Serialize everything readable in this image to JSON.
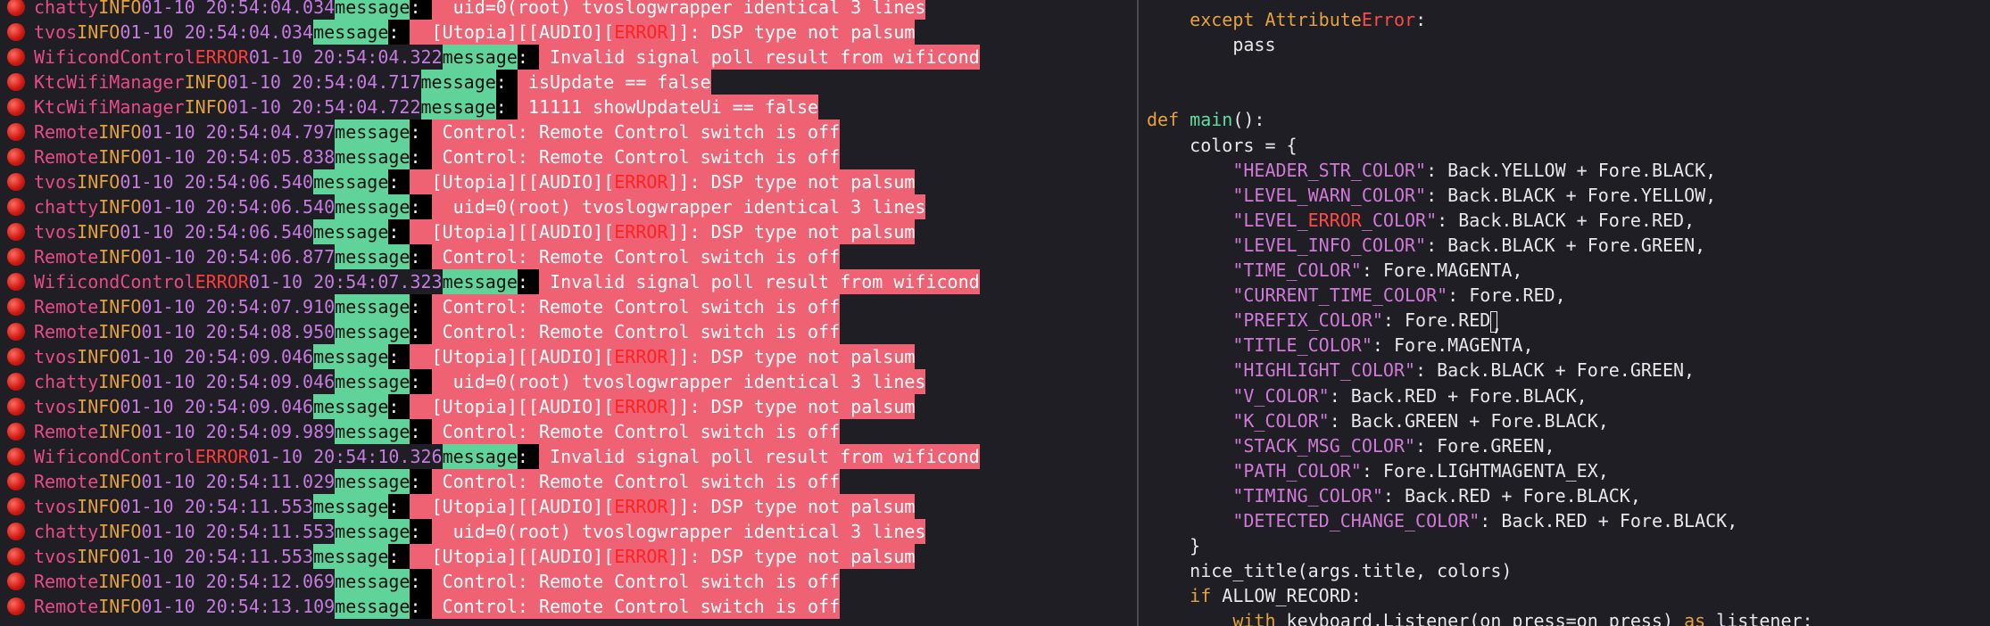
{
  "log": {
    "lines": [
      {
        "tag": "chatty",
        "level": "INFO",
        "time": "01-10 20:54:04.034",
        "key": "message",
        "pre": "  uid=0(root) tvoslogwrapper identical 3 lines",
        "err": "",
        "post": ""
      },
      {
        "tag": "tvos",
        "level": "INFO",
        "time": "01-10 20:54:04.034",
        "key": "message",
        "pre": "  [Utopia][[AUDIO][",
        "err": "ERROR",
        "post": "]]: DSP type not palsum"
      },
      {
        "tag": "WificondControl",
        "level": "ERROR",
        "time": "01-10 20:54:04.322",
        "key": "message",
        "pre": " Invalid signal poll result from wificond",
        "err": "",
        "post": ""
      },
      {
        "tag": "KtcWifiManager",
        "level": "INFO",
        "time": "01-10 20:54:04.717",
        "key": "message",
        "pre": " isUpdate == false",
        "err": "",
        "post": ""
      },
      {
        "tag": "KtcWifiManager",
        "level": "INFO",
        "time": "01-10 20:54:04.722",
        "key": "message",
        "pre": " 11111 showUpdateUi == false",
        "err": "",
        "post": ""
      },
      {
        "tag": "Remote",
        "level": "INFO",
        "time": "01-10 20:54:04.797",
        "key": "message",
        "pre": " Control: Remote Control switch is off",
        "err": "",
        "post": ""
      },
      {
        "tag": "Remote",
        "level": "INFO",
        "time": "01-10 20:54:05.838",
        "key": "message",
        "pre": " Control: Remote Control switch is off",
        "err": "",
        "post": ""
      },
      {
        "tag": "tvos",
        "level": "INFO",
        "time": "01-10 20:54:06.540",
        "key": "message",
        "pre": "  [Utopia][[AUDIO][",
        "err": "ERROR",
        "post": "]]: DSP type not palsum"
      },
      {
        "tag": "chatty",
        "level": "INFO",
        "time": "01-10 20:54:06.540",
        "key": "message",
        "pre": "  uid=0(root) tvoslogwrapper identical 3 lines",
        "err": "",
        "post": ""
      },
      {
        "tag": "tvos",
        "level": "INFO",
        "time": "01-10 20:54:06.540",
        "key": "message",
        "pre": "  [Utopia][[AUDIO][",
        "err": "ERROR",
        "post": "]]: DSP type not palsum"
      },
      {
        "tag": "Remote",
        "level": "INFO",
        "time": "01-10 20:54:06.877",
        "key": "message",
        "pre": " Control: Remote Control switch is off",
        "err": "",
        "post": ""
      },
      {
        "tag": "WificondControl",
        "level": "ERROR",
        "time": "01-10 20:54:07.323",
        "key": "message",
        "pre": " Invalid signal poll result from wificond",
        "err": "",
        "post": ""
      },
      {
        "tag": "Remote",
        "level": "INFO",
        "time": "01-10 20:54:07.910",
        "key": "message",
        "pre": " Control: Remote Control switch is off",
        "err": "",
        "post": ""
      },
      {
        "tag": "Remote",
        "level": "INFO",
        "time": "01-10 20:54:08.950",
        "key": "message",
        "pre": " Control: Remote Control switch is off",
        "err": "",
        "post": ""
      },
      {
        "tag": "tvos",
        "level": "INFO",
        "time": "01-10 20:54:09.046",
        "key": "message",
        "pre": "  [Utopia][[AUDIO][",
        "err": "ERROR",
        "post": "]]: DSP type not palsum"
      },
      {
        "tag": "chatty",
        "level": "INFO",
        "time": "01-10 20:54:09.046",
        "key": "message",
        "pre": "  uid=0(root) tvoslogwrapper identical 3 lines",
        "err": "",
        "post": ""
      },
      {
        "tag": "tvos",
        "level": "INFO",
        "time": "01-10 20:54:09.046",
        "key": "message",
        "pre": "  [Utopia][[AUDIO][",
        "err": "ERROR",
        "post": "]]: DSP type not palsum"
      },
      {
        "tag": "Remote",
        "level": "INFO",
        "time": "01-10 20:54:09.989",
        "key": "message",
        "pre": " Control: Remote Control switch is off",
        "err": "",
        "post": ""
      },
      {
        "tag": "WificondControl",
        "level": "ERROR",
        "time": "01-10 20:54:10.326",
        "key": "message",
        "pre": " Invalid signal poll result from wificond",
        "err": "",
        "post": ""
      },
      {
        "tag": "Remote",
        "level": "INFO",
        "time": "01-10 20:54:11.029",
        "key": "message",
        "pre": " Control: Remote Control switch is off",
        "err": "",
        "post": ""
      },
      {
        "tag": "tvos",
        "level": "INFO",
        "time": "01-10 20:54:11.553",
        "key": "message",
        "pre": "  [Utopia][[AUDIO][",
        "err": "ERROR",
        "post": "]]: DSP type not palsum"
      },
      {
        "tag": "chatty",
        "level": "INFO",
        "time": "01-10 20:54:11.553",
        "key": "message",
        "pre": "  uid=0(root) tvoslogwrapper identical 3 lines",
        "err": "",
        "post": ""
      },
      {
        "tag": "tvos",
        "level": "INFO",
        "time": "01-10 20:54:11.553",
        "key": "message",
        "pre": "  [Utopia][[AUDIO][",
        "err": "ERROR",
        "post": "]]: DSP type not palsum"
      },
      {
        "tag": "Remote",
        "level": "INFO",
        "time": "01-10 20:54:12.069",
        "key": "message",
        "pre": " Control: Remote Control switch is off",
        "err": "",
        "post": ""
      },
      {
        "tag": "Remote",
        "level": "INFO",
        "time": "01-10 20:54:13.109",
        "key": "message",
        "pre": " Control: Remote Control switch is off",
        "err": "",
        "post": ""
      }
    ]
  },
  "editor": {
    "lines": [
      [
        {
          "t": "    "
        },
        {
          "t": "except",
          "c": "kw"
        },
        {
          "t": " "
        },
        {
          "t": "Attribute",
          "c": "cls"
        },
        {
          "t": "Error",
          "c": "err"
        },
        {
          "t": ":"
        }
      ],
      [
        {
          "t": "        pass"
        }
      ],
      [
        {
          "t": ""
        }
      ],
      [
        {
          "t": ""
        }
      ],
      [
        {
          "t": "def",
          "c": "kw"
        },
        {
          "t": " "
        },
        {
          "t": "main",
          "c": "fn"
        },
        {
          "t": "():"
        }
      ],
      [
        {
          "t": "    colors = {"
        }
      ],
      [
        {
          "t": "        "
        },
        {
          "t": "\"HEADER_STR_COLOR\"",
          "c": "str"
        },
        {
          "t": ": Back.YELLOW + Fore.BLACK,"
        }
      ],
      [
        {
          "t": "        "
        },
        {
          "t": "\"LEVEL_WARN_COLOR\"",
          "c": "str"
        },
        {
          "t": ": Back.BLACK + Fore.YELLOW,"
        }
      ],
      [
        {
          "t": "        "
        },
        {
          "t": "\"LEVEL_",
          "c": "str"
        },
        {
          "t": "ERROR",
          "c": "err"
        },
        {
          "t": "_COLOR\"",
          "c": "str"
        },
        {
          "t": ": Back.BLACK + Fore.RED,"
        }
      ],
      [
        {
          "t": "        "
        },
        {
          "t": "\"LEVEL_INFO_COLOR\"",
          "c": "str"
        },
        {
          "t": ": Back.BLACK + Fore.GREEN,"
        }
      ],
      [
        {
          "t": "        "
        },
        {
          "t": "\"TIME_COLOR\"",
          "c": "str"
        },
        {
          "t": ": Fore.MAGENTA,"
        }
      ],
      [
        {
          "t": "        "
        },
        {
          "t": "\"CURRENT_TIME_COLOR\"",
          "c": "str"
        },
        {
          "t": ": Fore.RED,"
        }
      ],
      [
        {
          "t": "        "
        },
        {
          "t": "\"PREFIX_COLOR\"",
          "c": "str"
        },
        {
          "t": ": Fore.RED"
        },
        {
          "t": ",",
          "c": "cursor-char"
        }
      ],
      [
        {
          "t": "        "
        },
        {
          "t": "\"TITLE_COLOR\"",
          "c": "str"
        },
        {
          "t": ": Fore.MAGENTA,"
        }
      ],
      [
        {
          "t": "        "
        },
        {
          "t": "\"HIGHLIGHT_COLOR\"",
          "c": "str"
        },
        {
          "t": ": Back.BLACK + Fore.GREEN,"
        }
      ],
      [
        {
          "t": "        "
        },
        {
          "t": "\"V_COLOR\"",
          "c": "str"
        },
        {
          "t": ": Back.RED + Fore.BLACK,"
        }
      ],
      [
        {
          "t": "        "
        },
        {
          "t": "\"K_COLOR\"",
          "c": "str"
        },
        {
          "t": ": Back.GREEN + Fore.BLACK,"
        }
      ],
      [
        {
          "t": "        "
        },
        {
          "t": "\"STACK_MSG_COLOR\"",
          "c": "str"
        },
        {
          "t": ": Fore.GREEN,"
        }
      ],
      [
        {
          "t": "        "
        },
        {
          "t": "\"PATH_COLOR\"",
          "c": "str"
        },
        {
          "t": ": Fore.LIGHTMAGENTA_EX,"
        }
      ],
      [
        {
          "t": "        "
        },
        {
          "t": "\"TIMING_COLOR\"",
          "c": "str"
        },
        {
          "t": ": Back.RED + Fore.BLACK,"
        }
      ],
      [
        {
          "t": "        "
        },
        {
          "t": "\"DETECTED_CHANGE_COLOR\"",
          "c": "str"
        },
        {
          "t": ": Back.RED + Fore.BLACK,"
        }
      ],
      [
        {
          "t": "    }"
        }
      ],
      [
        {
          "t": "    nice_title(args.title, colors)"
        }
      ],
      [
        {
          "t": "    "
        },
        {
          "t": "if",
          "c": "kw"
        },
        {
          "t": " ALLOW_RECORD:"
        }
      ],
      [
        {
          "t": "        "
        },
        {
          "t": "with",
          "c": "kw"
        },
        {
          "t": " keyboard.Listener(on_press=on_press) "
        },
        {
          "t": "as",
          "c": "kw"
        },
        {
          "t": " listener:"
        }
      ]
    ]
  }
}
